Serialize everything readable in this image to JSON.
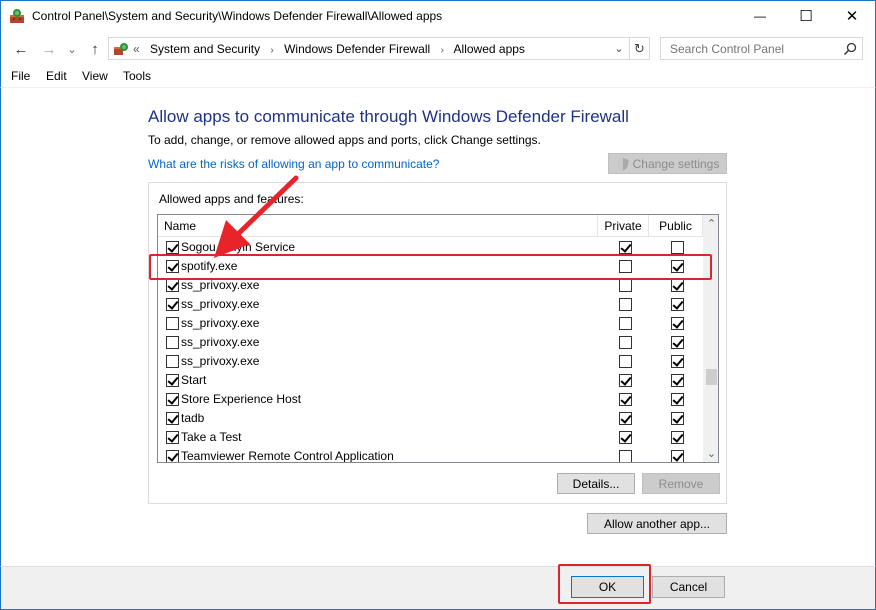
{
  "window": {
    "title": "Control Panel\\System and Security\\Windows Defender Firewall\\Allowed apps",
    "minimize_glyph": "—",
    "maximize_glyph": "☐",
    "close_glyph": "✕"
  },
  "nav": {
    "back_glyph": "←",
    "forward_glyph": "→",
    "recent_glyph": "⌄",
    "up_glyph": "↑",
    "overflow": "«",
    "breadcrumbs": [
      "System and Security",
      "Windows Defender Firewall",
      "Allowed apps"
    ],
    "breadcrumb_sep": "›",
    "dropdown_glyph": "⌄",
    "refresh_glyph": "↻",
    "search_placeholder": "Search Control Panel"
  },
  "menu": [
    "File",
    "Edit",
    "View",
    "Tools"
  ],
  "main": {
    "heading": "Allow apps to communicate through Windows Defender Firewall",
    "subtext": "To add, change, or remove allowed apps and ports, click Change settings.",
    "risk_link": "What are the risks of allowing an app to communicate?",
    "change_settings": "Change settings",
    "group_label": "Allowed apps and features:",
    "columns": {
      "name": "Name",
      "private": "Private",
      "public": "Public"
    },
    "rows": [
      {
        "name": "Sogou Pinyin Service",
        "enabled": true,
        "private": true,
        "public": false
      },
      {
        "name": "spotify.exe",
        "enabled": true,
        "private": false,
        "public": true
      },
      {
        "name": "ss_privoxy.exe",
        "enabled": true,
        "private": false,
        "public": true
      },
      {
        "name": "ss_privoxy.exe",
        "enabled": true,
        "private": false,
        "public": true
      },
      {
        "name": "ss_privoxy.exe",
        "enabled": false,
        "private": false,
        "public": true
      },
      {
        "name": "ss_privoxy.exe",
        "enabled": false,
        "private": false,
        "public": true
      },
      {
        "name": "ss_privoxy.exe",
        "enabled": false,
        "private": false,
        "public": true
      },
      {
        "name": "Start",
        "enabled": true,
        "private": true,
        "public": true
      },
      {
        "name": "Store Experience Host",
        "enabled": true,
        "private": true,
        "public": true
      },
      {
        "name": "tadb",
        "enabled": true,
        "private": true,
        "public": true
      },
      {
        "name": "Take a Test",
        "enabled": true,
        "private": true,
        "public": true
      },
      {
        "name": "Teamviewer Remote Control Application",
        "enabled": true,
        "private": false,
        "public": true
      }
    ],
    "scroll_up_glyph": "⌃",
    "scroll_down_glyph": "⌄",
    "details": "Details...",
    "remove": "Remove",
    "allow_another": "Allow another app..."
  },
  "footer": {
    "ok": "OK",
    "cancel": "Cancel"
  },
  "colors": {
    "accent": "#1a73c7",
    "heading": "#1e3287",
    "link": "#0066cc",
    "annotation": "#d9262c"
  }
}
